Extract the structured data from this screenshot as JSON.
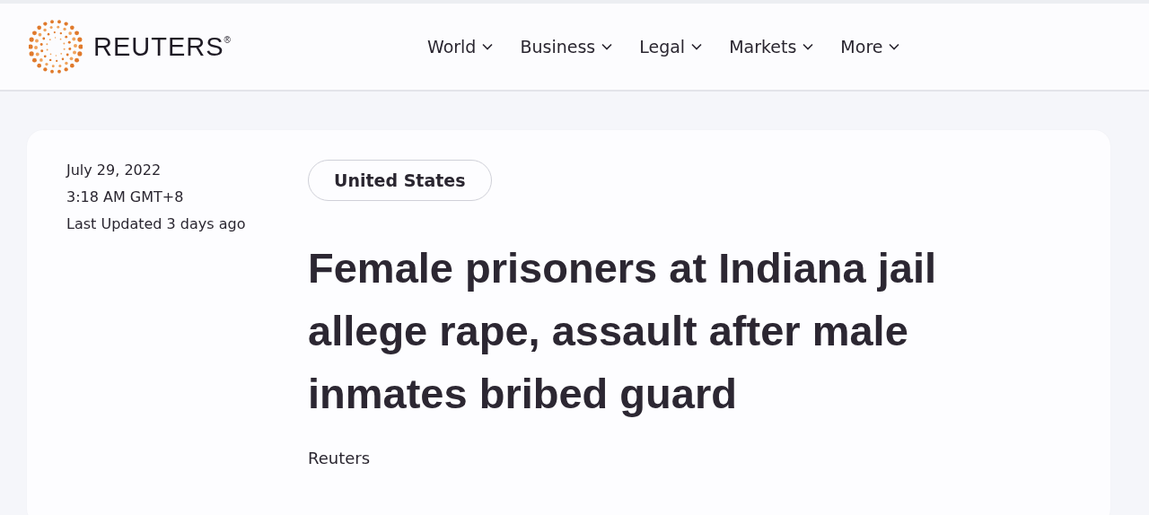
{
  "header": {
    "logo": "REUTERS$^{®}$",
    "nav": [
      {
        "label": "World"
      },
      {
        "label": "Business"
      },
      {
        "label": "Legal"
      },
      {
        "label": "Markets"
      },
      {
        "label": "More"
      }
    ]
  },
  "article": {
    "date": "July 29, 2022",
    "time": "3:18 AM GMT+8",
    "updated": "Last Updated 3 days ago",
    "tag": "United States",
    "headline": "Female prisoners at Indiana jail allege rape, assault after male inmates bribed guard",
    "byline": "Reuters"
  }
}
